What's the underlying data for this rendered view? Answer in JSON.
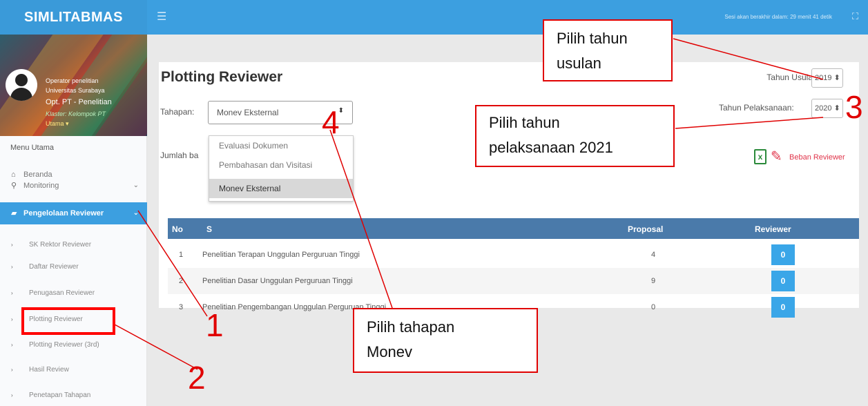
{
  "brand": "SIMLITABMAS",
  "user": {
    "role": "Operator penelitian",
    "institution": "Universitas Surabaya",
    "name": "Opt. PT - Penelitian",
    "cluster": "Klaster: Kelompok PT",
    "status": "Utama"
  },
  "sidebar": {
    "menu_title": "Menu Utama",
    "items": [
      {
        "label": "Beranda",
        "icon": "home-icon"
      },
      {
        "label": "Monitoring",
        "icon": "search-icon"
      },
      {
        "label": "Pengelolaan Reviewer",
        "icon": "book-icon"
      }
    ],
    "subitems": [
      "SK Rektor Reviewer",
      "Daftar Reviewer",
      "Penugasan Reviewer",
      "Plotting Reviewer",
      "Plotting Reviewer (3rd)",
      "Hasil Review",
      "Penetapan Tahapan"
    ]
  },
  "topbar": {
    "session_text": "Sesi akan berakhir dalam: 29 menit 41 detik"
  },
  "main": {
    "title": "Plotting Reviewer",
    "tahapan_label": "Tahapan:",
    "tahapan_value": "Monev Eksternal",
    "dropdown_options": [
      "Evaluasi Dokumen",
      "Pembahasan dan Visitasi",
      "Monev Eksternal"
    ],
    "jumlah_label": "Jumlah ba",
    "tahun_usulan_label": "Tahun Usulan:",
    "tahun_usulan_value": "2019",
    "tahun_pelaksanaan_label": "Tahun Pelaksanaan:",
    "tahun_pelaksanaan_value": "2020",
    "beban_label": "Beban Reviewer"
  },
  "table": {
    "headers": [
      "No",
      "S",
      "Proposal",
      "Reviewer"
    ],
    "rows": [
      {
        "no": "1",
        "skema": "Penelitian Terapan Unggulan Perguruan Tinggi",
        "proposal": "4",
        "reviewer": "0"
      },
      {
        "no": "2",
        "skema": "Penelitian Dasar Unggulan Perguruan Tinggi",
        "proposal": "9",
        "reviewer": "0"
      },
      {
        "no": "3",
        "skema": "Penelitian Pengembangan Unggulan Perguruan Tinggi",
        "proposal": "0",
        "reviewer": "0"
      }
    ]
  },
  "annotations": {
    "callout_tahun_usulan": [
      "Pilih tahun",
      "usulan"
    ],
    "callout_tahun_pelaksanaan": [
      "Pilih tahun",
      "pelaksanaan 2021"
    ],
    "callout_tahapan": [
      "Pilih tahapan",
      "Monev"
    ],
    "numbers": [
      "1",
      "2",
      "3",
      "4"
    ],
    "color": "#e00000"
  }
}
